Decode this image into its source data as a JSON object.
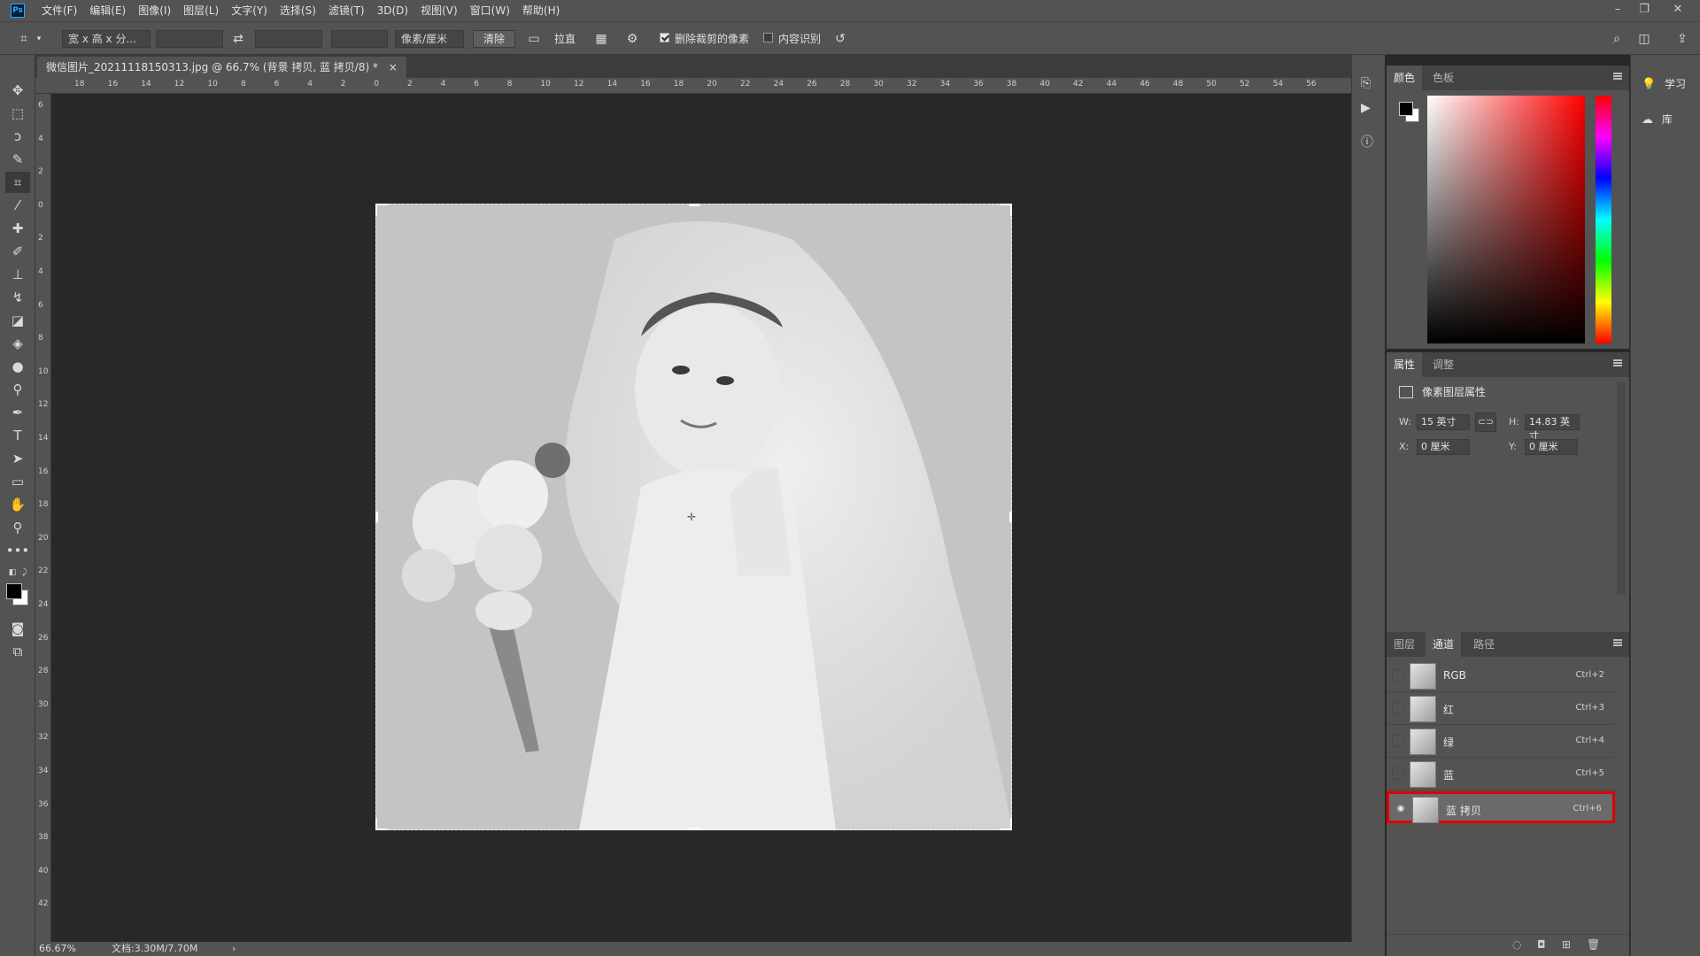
{
  "menubar": {
    "logo": "Ps",
    "items": [
      "文件(F)",
      "编辑(E)",
      "图像(I)",
      "图层(L)",
      "文字(Y)",
      "选择(S)",
      "滤镜(T)",
      "3D(D)",
      "视图(V)",
      "窗口(W)",
      "帮助(H)"
    ],
    "window_controls": [
      "minimize-icon",
      "restore-icon",
      "close-icon"
    ]
  },
  "options": {
    "ratio_select": "宽 x 高 x 分...",
    "width_value": "",
    "height_value": "",
    "resolution_value": "",
    "unit_select": "像素/厘米",
    "clear_button": "清除",
    "straighten_label": "拉直",
    "delete_cropped_label": "删除裁剪的像素",
    "delete_cropped_checked": true,
    "content_aware_label": "内容识别",
    "content_aware_checked": false
  },
  "document": {
    "tab_title": "微信图片_20211118150313.jpg @ 66.7% (背景 拷贝, 蓝 拷贝/8) *",
    "close_glyph": "×"
  },
  "rulers": {
    "top_labels": [
      "18",
      "16",
      "14",
      "12",
      "10",
      "8",
      "6",
      "4",
      "2",
      "0",
      "2",
      "4",
      "6",
      "8",
      "10",
      "12",
      "14",
      "16",
      "18",
      "20",
      "22",
      "24",
      "26",
      "28",
      "30",
      "32",
      "34",
      "36",
      "38",
      "40",
      "42",
      "44",
      "46",
      "48",
      "50",
      "52",
      "54",
      "56"
    ],
    "left_labels": [
      "6",
      "4",
      "2",
      "0",
      "2",
      "4",
      "6",
      "8",
      "10",
      "12",
      "14",
      "16",
      "18",
      "20",
      "22",
      "24",
      "26",
      "28",
      "30",
      "32",
      "34",
      "36",
      "38",
      "40",
      "42"
    ]
  },
  "color_panel": {
    "tabs": [
      "颜色",
      "色板"
    ],
    "active_tab": "颜色",
    "foreground": "#000000",
    "background": "#ffffff",
    "hue_color": "#ff0000"
  },
  "properties_panel": {
    "tabs": [
      "属性",
      "调整"
    ],
    "active_tab": "属性",
    "heading": "像素图层属性",
    "w_label": "W:",
    "w_value": "15 英寸",
    "h_label": "H:",
    "h_value": "14.83 英寸",
    "x_label": "X:",
    "x_value": "0 厘米",
    "y_label": "Y:",
    "y_value": "0 厘米"
  },
  "channels_panel": {
    "tabs": [
      "图层",
      "通道",
      "路径"
    ],
    "active_tab": "通道",
    "channels": [
      {
        "name": "RGB",
        "shortcut": "Ctrl+2",
        "visible": false,
        "selected": false
      },
      {
        "name": "红",
        "shortcut": "Ctrl+3",
        "visible": false,
        "selected": false
      },
      {
        "name": "绿",
        "shortcut": "Ctrl+4",
        "visible": false,
        "selected": false
      },
      {
        "name": "蓝",
        "shortcut": "Ctrl+5",
        "visible": false,
        "selected": false
      },
      {
        "name": "蓝 拷贝",
        "shortcut": "Ctrl+6",
        "visible": true,
        "selected": true
      }
    ],
    "highlight_color": "#e00000"
  },
  "right_strip": {
    "learn_label": "学习",
    "library_label": "库"
  },
  "status": {
    "zoom": "66.67%",
    "doc_size": "文档:3.30M/7.70M",
    "arrow": "›"
  }
}
